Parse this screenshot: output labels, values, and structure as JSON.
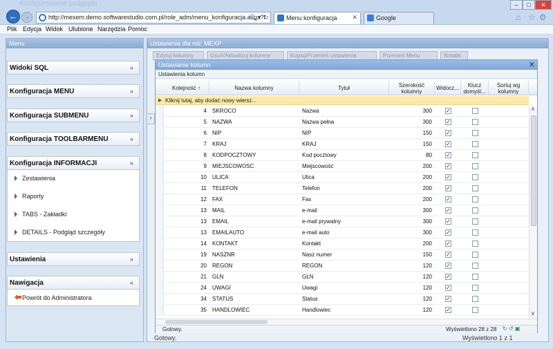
{
  "browser": {
    "faded_title": "Konfigurowanie podglądu",
    "address": "http://mexem.demo.softwarestudio.com.pl/role_adm/menu_konfiguracja.aspx?i",
    "tabs": [
      {
        "label": "Menu konfiguracja",
        "icon": "ie-page-icon"
      },
      {
        "label": "Google",
        "icon": "google-icon"
      }
    ],
    "window_buttons": [
      "–",
      "□",
      "✕"
    ],
    "colors": {
      "accent": "#2d6fc0"
    }
  },
  "menubar": [
    "Plik",
    "Edycja",
    "Widok",
    "Ulubione",
    "Narzędzia",
    "Pomoc"
  ],
  "left_panel": {
    "title": "Menu",
    "sections": [
      {
        "label": "Widoki SQL",
        "chevron": "»"
      },
      {
        "label": "Konfiguracja MENU",
        "chevron": "»"
      },
      {
        "label": "Konfiguracja SUBMENU",
        "chevron": "»"
      },
      {
        "label": "Konfiguracja TOOLBARMENU",
        "chevron": "»"
      },
      {
        "label": "Konfiguracja INFORMACJI",
        "chevron": "«"
      },
      {
        "label": "Ustawienia",
        "chevron": "»"
      },
      {
        "label": "Nawigacja",
        "chevron": "«"
      }
    ],
    "informacji_items": [
      "Zestawienia",
      "Raporty",
      "TABS - Zakładki",
      "DETAILS - Podgląd szczegóły"
    ],
    "nawigacja_items": [
      "Powrót do Administratora"
    ]
  },
  "right_panel": {
    "title": "Ustawienia dla roli: MEXP",
    "toolbar_tabs": [
      "Edytuj kolumny",
      "Usuń/Aktualizuj kolumny",
      "Kopiuj/Przenieś ustawienia",
      "Przenieś Menu",
      "Notatki"
    ],
    "status": "Gotowy.",
    "status_right": "Wyświetlono 1 z 1"
  },
  "dialog": {
    "title": "Ustawianie kolumn",
    "subtitle": "Ustawienia kolumn",
    "columns": [
      "Kolejność ↑",
      "Nazwa kolumny",
      "Tytuł",
      "Szerokość kolumny",
      "Widocz...",
      "Klucz domyśl...",
      "Sortuj wg kolumny"
    ],
    "new_row": "Kliknij tutaj, aby dodać nowy wiersz...",
    "rows": [
      {
        "order": "4",
        "name": "SKROCO",
        "title": "Nazwa",
        "width": "300",
        "visible": true,
        "key": false
      },
      {
        "order": "5",
        "name": "NAZWA",
        "title": "Nazwa pełna",
        "width": "300",
        "visible": true,
        "key": false
      },
      {
        "order": "6",
        "name": "NIP",
        "title": "NIP",
        "width": "150",
        "visible": true,
        "key": false
      },
      {
        "order": "7",
        "name": "KRAJ",
        "title": "KRAJ",
        "width": "150",
        "visible": true,
        "key": false
      },
      {
        "order": "8",
        "name": "KODPOCZTOWY",
        "title": "Kod pocztowy",
        "width": "80",
        "visible": true,
        "key": false
      },
      {
        "order": "9",
        "name": "MIEJSCOWOSC",
        "title": "Miejscowość",
        "width": "200",
        "visible": true,
        "key": false
      },
      {
        "order": "10",
        "name": "ULICA",
        "title": "Ulica",
        "width": "200",
        "visible": true,
        "key": false
      },
      {
        "order": "11",
        "name": "TELEFON",
        "title": "Telefon",
        "width": "200",
        "visible": true,
        "key": false
      },
      {
        "order": "12",
        "name": "FAX",
        "title": "Fax",
        "width": "200",
        "visible": true,
        "key": false
      },
      {
        "order": "13",
        "name": "MAIL",
        "title": "e-mail",
        "width": "300",
        "visible": true,
        "key": false
      },
      {
        "order": "13",
        "name": "EMAIL",
        "title": "e-mail prywatny",
        "width": "300",
        "visible": true,
        "key": false
      },
      {
        "order": "13",
        "name": "EMAILAUTO",
        "title": "e-mail auto",
        "width": "300",
        "visible": true,
        "key": false
      },
      {
        "order": "14",
        "name": "KONTAKT",
        "title": "Kontakt",
        "width": "200",
        "visible": true,
        "key": false
      },
      {
        "order": "19",
        "name": "NASZNR",
        "title": "Nasz numer",
        "width": "150",
        "visible": true,
        "key": false
      },
      {
        "order": "20",
        "name": "REGON",
        "title": "REGON",
        "width": "120",
        "visible": true,
        "key": false
      },
      {
        "order": "21",
        "name": "GLN",
        "title": "GLN",
        "width": "120",
        "visible": true,
        "key": false
      },
      {
        "order": "24",
        "name": "UWAGI",
        "title": "Uwagi",
        "width": "120",
        "visible": true,
        "key": false
      },
      {
        "order": "34",
        "name": "STATUS",
        "title": "Status",
        "width": "120",
        "visible": true,
        "key": false
      },
      {
        "order": "35",
        "name": "HANDLOWIEC",
        "title": "Handlowiec",
        "width": "120",
        "visible": true,
        "key": false
      }
    ],
    "status": "Gotowy.",
    "status_right": "Wyświetlono 28 z 28"
  }
}
